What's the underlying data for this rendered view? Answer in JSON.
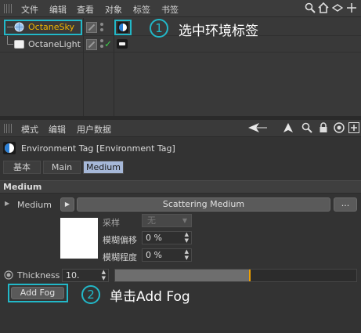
{
  "object_manager": {
    "menu": [
      "文件",
      "编辑",
      "查看",
      "对象",
      "标签",
      "书签"
    ],
    "toolbar_icons": [
      "search-icon",
      "home-icon",
      "back-icon",
      "drag-icon",
      "add-icon"
    ],
    "objects": [
      {
        "name": "OctaneSky",
        "selected": true,
        "tag": "environment-tag-icon"
      },
      {
        "name": "OctaneLight",
        "selected": false,
        "tag": "light-tag-icon"
      }
    ],
    "annotation_1": {
      "number": "1",
      "text": "选中环境标签"
    }
  },
  "attribute_manager": {
    "menu": [
      "模式",
      "编辑",
      "用户数据"
    ],
    "toolbar_icons": [
      "back-arrow-icon",
      "cursor-arrow-icon",
      "search-icon",
      "lock-icon",
      "target-icon",
      "add-icon"
    ],
    "title": "Environment Tag [Environment Tag]",
    "tabs": [
      "基本",
      "Main",
      "Medium"
    ],
    "active_tab": "Medium",
    "section": "Medium",
    "medium_label": "Medium",
    "medium_button": "Scattering Medium",
    "more_button": "...",
    "sampling_label": "采样",
    "sampling_value": "无",
    "blur_offset_label": "模糊偏移",
    "blur_offset_value": "0 %",
    "blur_amount_label": "模糊程度",
    "blur_amount_value": "0 %",
    "thickness_label": "Thickness",
    "thickness_value": "10.",
    "thickness_slider_fraction": 0.56,
    "add_fog_button": "Add Fog",
    "annotation_2": {
      "number": "2",
      "text": "单击Add Fog"
    }
  },
  "colors": {
    "accent": "#22b8c8",
    "active_tab": "#a6b8d8",
    "selected_text": "#f0b400",
    "slider_marker": "#f0a000"
  }
}
